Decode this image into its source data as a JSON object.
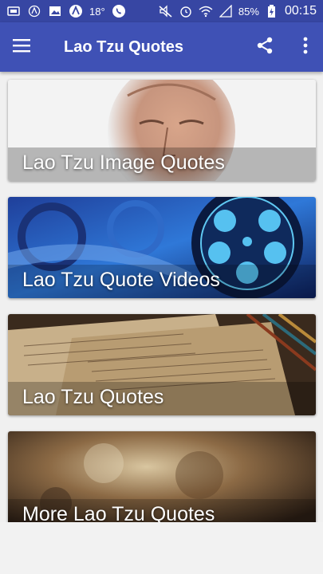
{
  "status_bar": {
    "temperature": "18°",
    "battery": "85%",
    "time": "00:15"
  },
  "app_bar": {
    "title": "Lao Tzu Quotes",
    "icons": [
      "menu-icon",
      "share-icon",
      "more-vert-icon"
    ]
  },
  "cards": [
    {
      "label": "Lao Tzu Image Quotes"
    },
    {
      "label": "Lao Tzu Quote Videos"
    },
    {
      "label": "Lao Tzu Quotes"
    },
    {
      "label": "More Lao Tzu Quotes"
    }
  ],
  "colors": {
    "status_bar": "#3746a3",
    "app_bar": "#3f51b5"
  }
}
